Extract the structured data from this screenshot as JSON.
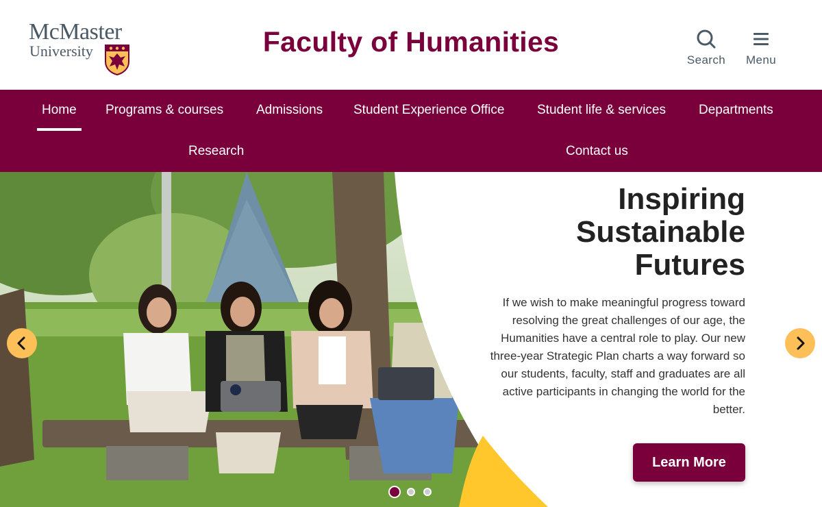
{
  "header": {
    "logo_name": "McMaster",
    "logo_university": "University",
    "site_title": "Faculty of Humanities",
    "search_label": "Search",
    "menu_label": "Menu"
  },
  "nav": {
    "items": [
      {
        "label": "Home",
        "active": true
      },
      {
        "label": "Programs & courses"
      },
      {
        "label": "Admissions"
      },
      {
        "label": "Student Experience Office"
      },
      {
        "label": "Student life & services"
      },
      {
        "label": "Departments"
      },
      {
        "label": "Research"
      },
      {
        "label": "Contact us"
      }
    ]
  },
  "hero": {
    "title_line1": "Inspiring",
    "title_line2": "Sustainable",
    "title_line3": "Futures",
    "text": "If we wish to make meaningful progress toward resolving the great challenges of our age, the Humanities have a central role to play. Our new three-year Strategic Plan charts a way forward so our students, faculty, staff and graduates are all active participants in changing the world for the better.",
    "cta_label": "Learn More",
    "slide_count": 3,
    "current_slide": 1
  },
  "icons": {
    "search": "search-icon",
    "menu": "hamburger-menu-icon",
    "prev": "chevron-left-icon",
    "next": "chevron-right-icon",
    "crest": "mcmaster-crest-icon"
  },
  "colors": {
    "brand_maroon": "#7a003c",
    "brand_gold": "#fdbf57",
    "accent_yellow": "#ffc72c",
    "logo_grey": "#495965"
  }
}
